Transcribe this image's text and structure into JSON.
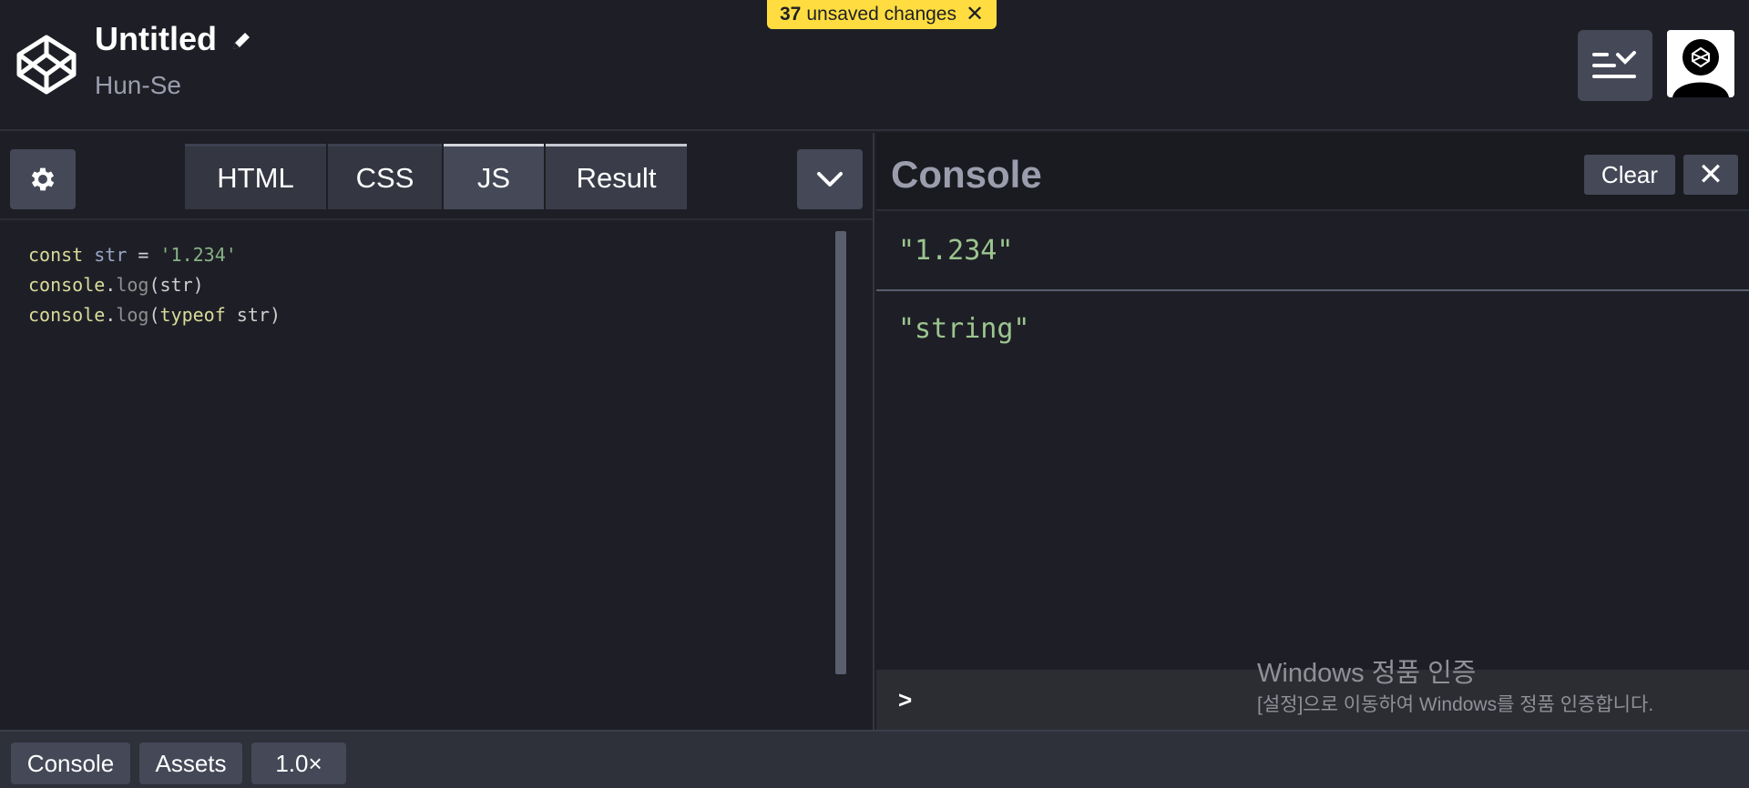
{
  "header": {
    "title": "Untitled",
    "author": "Hun-Se",
    "unsaved_count": "37",
    "unsaved_label": "unsaved changes",
    "unsaved_close": "✕"
  },
  "editor": {
    "tabs": [
      {
        "label": "HTML"
      },
      {
        "label": "CSS"
      },
      {
        "label": "JS"
      },
      {
        "label": "Result"
      }
    ],
    "active_tab": "JS",
    "code_lines": [
      [
        {
          "t": "const",
          "c": "kw"
        },
        {
          "t": " str",
          "c": "var"
        },
        {
          "t": " = ",
          "c": "plain"
        },
        {
          "t": "'1.234'",
          "c": "str"
        }
      ],
      [
        {
          "t": "console",
          "c": "kw"
        },
        {
          "t": ".",
          "c": "plain"
        },
        {
          "t": "log",
          "c": "fn"
        },
        {
          "t": "(",
          "c": "plain"
        },
        {
          "t": "str",
          "c": "plain"
        },
        {
          "t": ")",
          "c": "plain"
        }
      ],
      [
        {
          "t": "console",
          "c": "kw"
        },
        {
          "t": ".",
          "c": "plain"
        },
        {
          "t": "log",
          "c": "fn"
        },
        {
          "t": "(",
          "c": "plain"
        },
        {
          "t": "typeof",
          "c": "kw"
        },
        {
          "t": " str",
          "c": "plain"
        },
        {
          "t": ")",
          "c": "plain"
        }
      ]
    ]
  },
  "console": {
    "title": "Console",
    "clear_label": "Clear",
    "close_label": "✕",
    "logs": [
      "\"1.234\"",
      "\"string\""
    ],
    "prompt": ">",
    "watermark_title": "Windows 정품 인증",
    "watermark_sub": "[설정]으로 이동하여 Windows를 정품 인증합니다."
  },
  "footer": {
    "console_label": "Console",
    "assets_label": "Assets",
    "zoom_label": "1.0×"
  },
  "colors": {
    "accent_yellow": "#ffdd40",
    "button_bg": "#444857",
    "log_green": "#9cc58f"
  },
  "icons": [
    "codepen-logo-icon",
    "pencil-icon",
    "layout-icon",
    "avatar-icon",
    "gear-icon",
    "chevron-down-icon",
    "close-icon"
  ]
}
